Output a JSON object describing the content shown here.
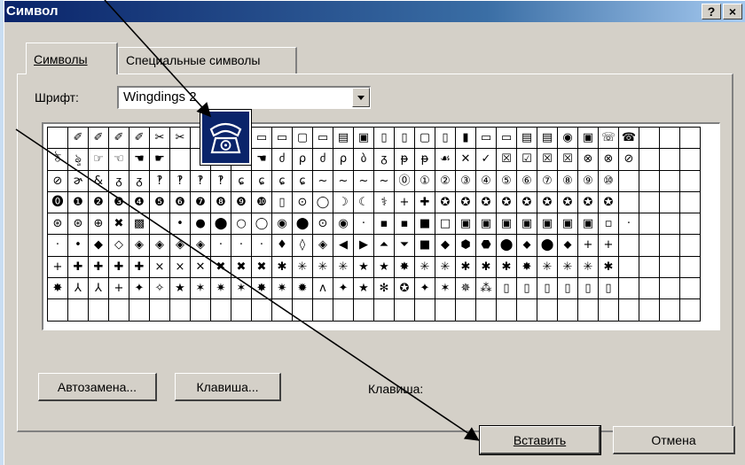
{
  "title": "Символ",
  "title_buttons": {
    "help": "?",
    "close": "×"
  },
  "tabs": [
    {
      "label": "Символы",
      "active": true
    },
    {
      "label": "Специальные символы",
      "active": false
    }
  ],
  "font": {
    "label": "Шрифт:",
    "value": "Wingdings 2"
  },
  "grid": {
    "rows": [
      [
        "",
        "✐",
        "✐",
        "✐",
        "✐",
        "✂",
        "✂",
        "",
        "",
        "",
        "▭",
        "▭",
        "▢",
        "▭",
        "▤",
        "▣",
        "▯",
        "▯",
        "▢",
        "▯",
        "▮",
        "▭",
        "▭",
        "▤",
        "▤",
        "◉",
        "▣",
        "☏",
        "☎",
        "",
        "",
        ""
      ],
      [
        "ঠ",
        "ৡ",
        "☞",
        "☜",
        "☚",
        "☛",
        "",
        "",
        "",
        "",
        "☚",
        "ძ",
        "ρ",
        "ძ",
        "ρ",
        "ბ",
        "ᵹ",
        "ᵽ",
        "ᵽ",
        "☙",
        "✕",
        "✓",
        "☒",
        "☑",
        "☒",
        "☒",
        "⊗",
        "⊗",
        "⊘",
        "",
        "",
        ""
      ],
      [
        "⊘",
        "ɚ",
        "&",
        "ᵹ",
        "ᵹ",
        "‽",
        "‽",
        "‽",
        "‽",
        "ɕ",
        "ɕ",
        "ɕ",
        "ɕ",
        "~",
        "~",
        "~",
        "~",
        "⓪",
        "①",
        "②",
        "③",
        "④",
        "⑤",
        "⑥",
        "⑦",
        "⑧",
        "⑨",
        "⑩",
        "",
        "",
        "",
        ""
      ],
      [
        "⓿",
        "❶",
        "❷",
        "❸",
        "❹",
        "❺",
        "❻",
        "❼",
        "❽",
        "❾",
        "❿",
        "▯",
        "⊙",
        "◯",
        "☽",
        "☾",
        "⚕",
        "+",
        "✚",
        "✪",
        "✪",
        "✪",
        "✪",
        "✪",
        "✪",
        "✪",
        "✪",
        "✪",
        "",
        "",
        "",
        ""
      ],
      [
        "⊛",
        "⊛",
        "⊕",
        "✖",
        "▩",
        "",
        "•",
        "●",
        "⬤",
        "○",
        "◯",
        "◉",
        "⬤",
        "⊙",
        "◉",
        "·",
        "▪",
        "▪",
        "■",
        "□",
        "▣",
        "▣",
        "▣",
        "▣",
        "▣",
        "▣",
        "▣",
        "▫",
        "·",
        "",
        "",
        ""
      ],
      [
        "·",
        "•",
        "◆",
        "◇",
        "◈",
        "◈",
        "◈",
        "◈",
        "·",
        "·",
        "·",
        "♦",
        "◊",
        "◈",
        "◀",
        "▶",
        "⏶",
        "⏷",
        "■",
        "◆",
        "⬢",
        "⬣",
        "⬤",
        "⬥",
        "⬤",
        "⬥",
        "+",
        "+",
        "",
        "",
        "",
        ""
      ],
      [
        "+",
        "✚",
        "✚",
        "✚",
        "✚",
        "×",
        "×",
        "✕",
        "✖",
        "✖",
        "✖",
        "✱",
        "✳",
        "✳",
        "✳",
        "★",
        "★",
        "✸",
        "✳",
        "✳",
        "✱",
        "✱",
        "✱",
        "✸",
        "✳",
        "✳",
        "✳",
        "✱",
        "",
        "",
        "",
        ""
      ],
      [
        "✸",
        "⅄",
        "⅄",
        "+",
        "✦",
        "✧",
        "★",
        "✶",
        "✷",
        "✶",
        "✸",
        "✷",
        "✹",
        "ᴧ",
        "✦",
        "★",
        "✻",
        "✪",
        "✦",
        "✶",
        "✵",
        "⁂",
        "▯",
        "▯",
        "▯",
        "▯",
        "▯",
        "▯",
        "",
        "",
        "",
        ""
      ],
      [
        "",
        "",
        "",
        "",
        "",
        "",
        "",
        "",
        "",
        "",
        "",
        "",
        "",
        "",
        "",
        "",
        "",
        "",
        "",
        "",
        "",
        "",
        "",
        "",
        "",
        "",
        "",
        "",
        "",
        "",
        "",
        ""
      ]
    ]
  },
  "buttons": {
    "autocorrect": "Автозамена...",
    "shortcut_key": "Клавиша...",
    "shortcut_label": "Клавиша:",
    "insert": "Вставить",
    "cancel": "Отмена"
  },
  "colors": {
    "title_start": "#0a246a",
    "title_end": "#a6caf0",
    "dialog_bg": "#d4d0c8",
    "desktop": "#c9ddf2"
  },
  "selected_symbol_icon": "telephone-icon"
}
